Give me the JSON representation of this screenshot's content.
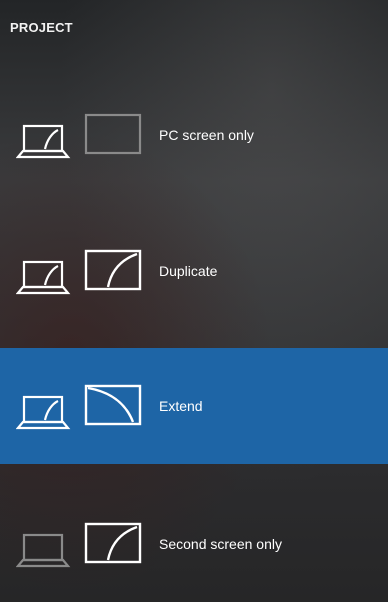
{
  "panel": {
    "title": "PROJECT"
  },
  "options": [
    {
      "id": "pc-screen-only",
      "label": "PC screen only",
      "selected": false
    },
    {
      "id": "duplicate",
      "label": "Duplicate",
      "selected": false
    },
    {
      "id": "extend",
      "label": "Extend",
      "selected": true
    },
    {
      "id": "second-screen-only",
      "label": "Second screen only",
      "selected": false
    }
  ],
  "colors": {
    "selected_background": "#1e65a6",
    "panel_background_top": "#232527",
    "panel_background_bottom": "#262627",
    "active_icon_stroke": "#ffffff",
    "inactive_icon_stroke": "#8a8a8a"
  },
  "icons": {
    "laptop": "laptop-icon",
    "monitor": "monitor-icon"
  }
}
